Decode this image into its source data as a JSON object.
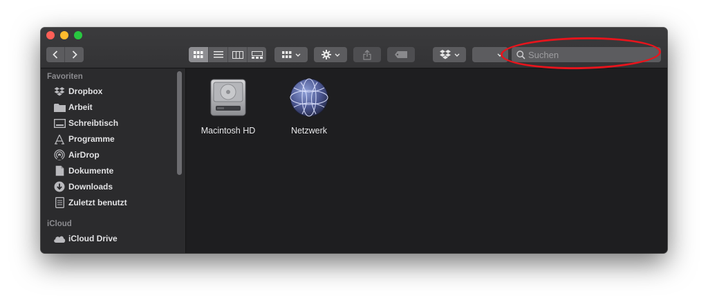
{
  "window": {
    "controls": [
      "close",
      "minimize",
      "zoom"
    ]
  },
  "toolbar": {
    "nav": {
      "back_icon": "chevron-left-icon",
      "forward_icon": "chevron-right-icon"
    },
    "view_modes": [
      "icon-view-icon",
      "list-view-icon",
      "column-view-icon",
      "gallery-view-icon"
    ],
    "search": {
      "placeholder": "Suchen",
      "value": ""
    }
  },
  "sidebar": {
    "favorites_title": "Favoriten",
    "favorites": [
      {
        "label": "Dropbox",
        "icon": "dropbox-icon"
      },
      {
        "label": "Arbeit",
        "icon": "folder-icon"
      },
      {
        "label": "Schreibtisch",
        "icon": "desktop-icon"
      },
      {
        "label": "Programme",
        "icon": "applications-icon"
      },
      {
        "label": "AirDrop",
        "icon": "airdrop-icon"
      },
      {
        "label": "Dokumente",
        "icon": "document-icon"
      },
      {
        "label": "Downloads",
        "icon": "download-icon"
      },
      {
        "label": "Zuletzt benutzt",
        "icon": "recents-icon"
      }
    ],
    "icloud_title": "iCloud",
    "icloud": [
      {
        "label": "iCloud Drive",
        "icon": "cloud-icon"
      }
    ]
  },
  "content": {
    "items": [
      {
        "label": "Macintosh HD",
        "icon": "hard-drive-icon"
      },
      {
        "label": "Netzwerk",
        "icon": "network-globe-icon"
      }
    ]
  },
  "colors": {
    "window_bg": "#1e1e20",
    "sidebar_bg": "#2b2b2d",
    "toolbar_bg": "#333335",
    "annotation": "#e8141c"
  }
}
